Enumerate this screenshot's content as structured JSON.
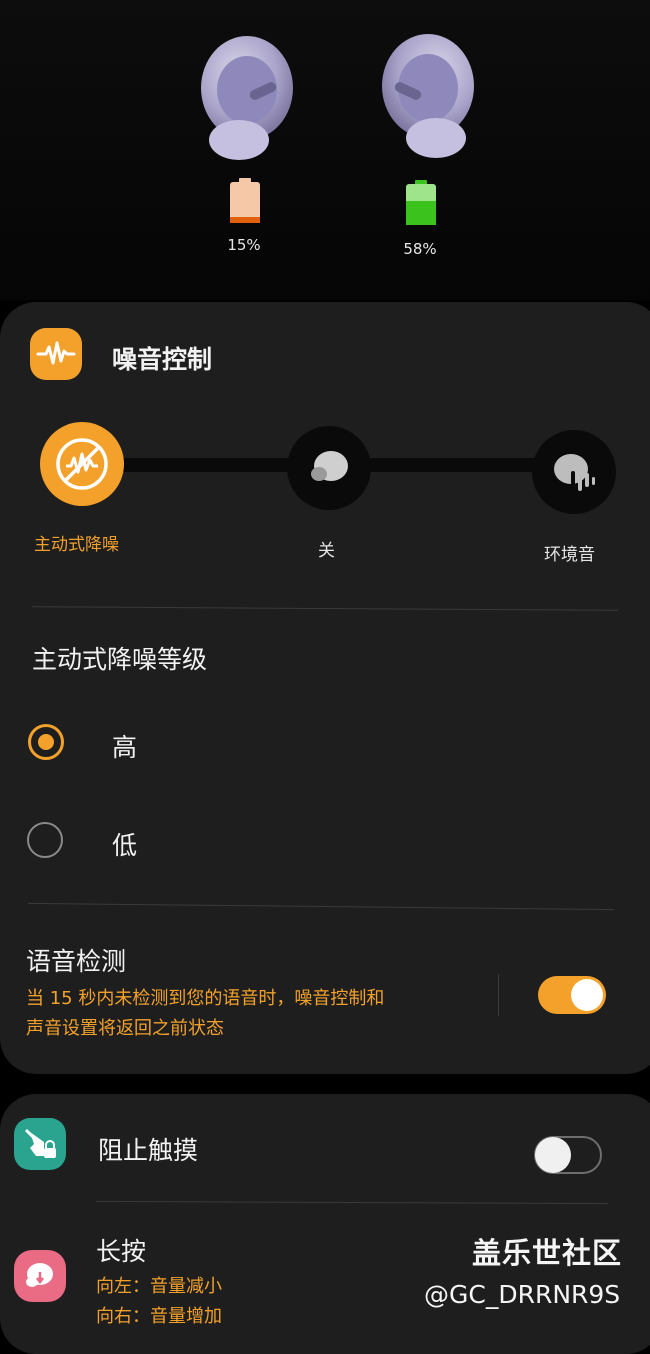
{
  "earbuds": {
    "left": {
      "battery_pct_text": "15%",
      "battery_level": 0.15,
      "battery_color": "#e06010"
    },
    "right": {
      "battery_pct_text": "58%",
      "battery_level": 0.58,
      "battery_color": "#3cc21c"
    },
    "bud_color": "#b8b2d8"
  },
  "noise_control": {
    "title": "噪音控制",
    "icon": "waveform-icon",
    "modes": [
      {
        "label": "主动式降噪",
        "icon": "anc-icon",
        "selected": true
      },
      {
        "label": "关",
        "icon": "earbud-off-icon",
        "selected": false
      },
      {
        "label": "环境音",
        "icon": "ambient-icon",
        "selected": false
      }
    ],
    "level_title": "主动式降噪等级",
    "levels": [
      {
        "label": "高",
        "selected": true
      },
      {
        "label": "低",
        "selected": false
      }
    ],
    "voice_detect": {
      "title": "语音检测",
      "desc_line1": "当 15 秒内未检测到您的语音时，噪音控制和",
      "desc_line2": "声音设置将返回之前状态",
      "enabled": true
    }
  },
  "block_touch": {
    "label": "阻止触摸",
    "icon": "touch-lock-icon",
    "enabled": false
  },
  "long_press": {
    "title": "长按",
    "icon": "earbud-touch-icon",
    "left_action": "向左：音量减小",
    "right_action": "向右：音量增加"
  },
  "watermark": {
    "line1": "盖乐世社区",
    "line2": "@GC_DRRNR9S"
  },
  "colors": {
    "accent": "#f3a12b",
    "card": "#1e1e1e",
    "background": "#000000"
  }
}
